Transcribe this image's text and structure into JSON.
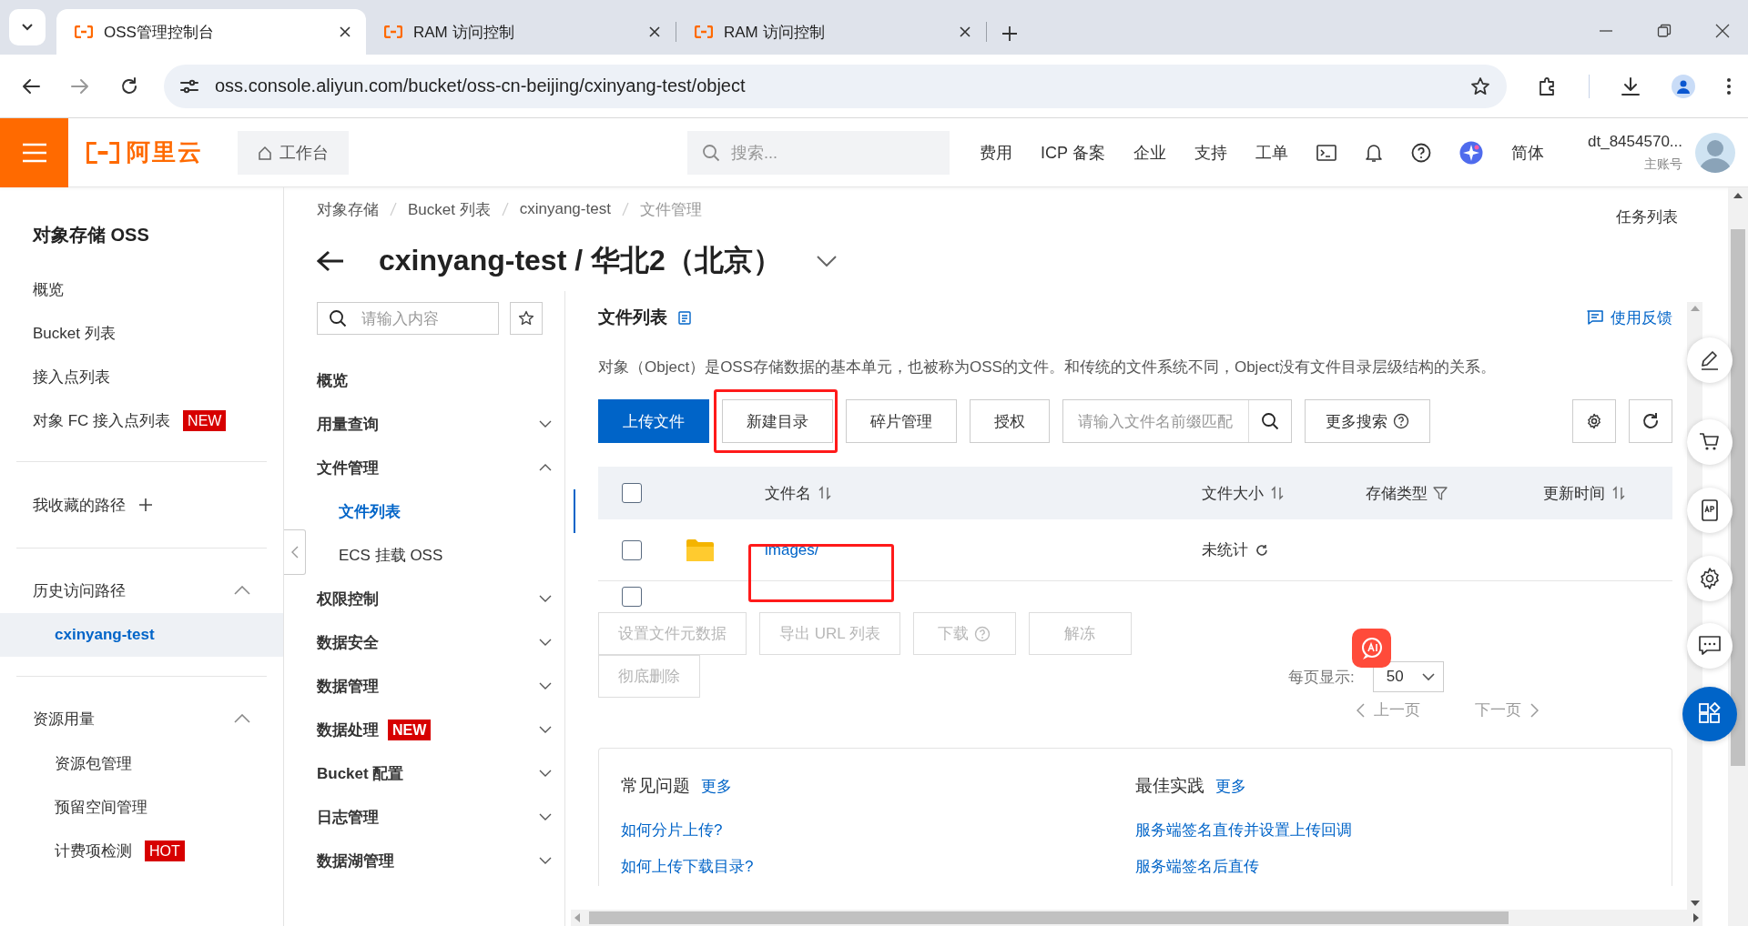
{
  "browser": {
    "tabs": [
      {
        "title": "OSS管理控制台",
        "selected": true
      },
      {
        "title": "RAM 访问控制",
        "selected": false
      },
      {
        "title": "RAM 访问控制",
        "selected": false
      }
    ],
    "url": "oss.console.aliyun.com/bucket/oss-cn-beijing/cxinyang-test/object"
  },
  "header": {
    "logo": "阿里云",
    "workbench": "工作台",
    "search_placeholder": "搜索...",
    "items": [
      {
        "kind": "text",
        "label": "费用"
      },
      {
        "kind": "text",
        "label": "ICP 备案"
      },
      {
        "kind": "text",
        "label": "企业"
      },
      {
        "kind": "text",
        "label": "支持"
      },
      {
        "kind": "text",
        "label": "工单"
      },
      {
        "kind": "terminal"
      },
      {
        "kind": "bell"
      },
      {
        "kind": "help"
      },
      {
        "kind": "assistant"
      },
      {
        "kind": "text",
        "label": "简体"
      }
    ],
    "user": "dt_8454570...",
    "account_type": "主账号"
  },
  "sidebar": {
    "title": "对象存储 OSS",
    "items": [
      {
        "label": "概览"
      },
      {
        "label": "Bucket 列表"
      },
      {
        "label": "接入点列表"
      },
      {
        "label": "对象 FC 接入点列表",
        "badge": "NEW"
      }
    ],
    "favorites": "我收藏的路径",
    "groups": [
      {
        "label": "历史访问路径",
        "expanded": true,
        "items": [
          {
            "label": "cxinyang-test",
            "selected": true
          }
        ]
      },
      {
        "label": "资源用量",
        "expanded": true,
        "items": [
          {
            "label": "资源包管理",
            "selected": false
          },
          {
            "label": "预留空间管理",
            "selected": false
          },
          {
            "label": "计费项检测",
            "selected": false,
            "badge": "HOT"
          }
        ]
      }
    ]
  },
  "breadcrumb": [
    "对象存储",
    "Bucket 列表",
    "cxinyang-test",
    "文件管理"
  ],
  "title": "cxinyang-test / 华北2（北京）",
  "task_list": "任务列表",
  "bucket_nav": {
    "search_placeholder": "请输入内容",
    "items": [
      {
        "label": "概览",
        "kind": "link"
      },
      {
        "label": "用量查询",
        "kind": "group",
        "expanded": false
      },
      {
        "label": "文件管理",
        "kind": "group",
        "expanded": true,
        "children": [
          {
            "label": "文件列表",
            "selected": true
          },
          {
            "label": "ECS 挂载 OSS",
            "selected": false
          }
        ]
      },
      {
        "label": "权限控制",
        "kind": "group",
        "expanded": false
      },
      {
        "label": "数据安全",
        "kind": "group",
        "expanded": false
      },
      {
        "label": "数据管理",
        "kind": "group",
        "expanded": false
      },
      {
        "label": "数据处理",
        "kind": "group",
        "expanded": false,
        "badge": "NEW"
      },
      {
        "label": "Bucket 配置",
        "kind": "group",
        "expanded": false
      },
      {
        "label": "日志管理",
        "kind": "group",
        "expanded": false
      },
      {
        "label": "数据湖管理",
        "kind": "group",
        "expanded": false
      }
    ]
  },
  "panel": {
    "title": "文件列表",
    "feedback": "使用反馈",
    "description": "对象（Object）是OSS存储数据的基本单元，也被称为OSS的文件。和传统的文件系统不同，Object没有文件目录层级结构的关系。",
    "toolbar": [
      {
        "label": "上传文件",
        "kind": "primary",
        "annotated": false
      },
      {
        "label": "新建目录",
        "kind": "default",
        "annotated": true
      },
      {
        "label": "碎片管理",
        "kind": "default",
        "annotated": false
      },
      {
        "label": "授权",
        "kind": "default",
        "annotated": false
      }
    ],
    "search_placeholder": "请输入文件名前缀匹配",
    "more_search": "更多搜索"
  },
  "table": {
    "select_all": false,
    "columns": [
      {
        "label": "文件名",
        "kind": "sort"
      },
      {
        "label": "文件大小",
        "kind": "sort"
      },
      {
        "label": "存储类型",
        "kind": "filter"
      },
      {
        "label": "更新时间",
        "kind": "sort"
      }
    ],
    "rows": [
      {
        "name": "images/",
        "size": "未统计",
        "checked": false,
        "annotated": true
      }
    ]
  },
  "bulk": {
    "checked": false,
    "actions": [
      {
        "label": "设置文件元数据",
        "disabled": true,
        "help": false
      },
      {
        "label": "导出 URL 列表",
        "disabled": true,
        "help": false
      },
      {
        "label": "下载",
        "disabled": true,
        "help": true
      },
      {
        "label": "解冻",
        "disabled": true,
        "help": false
      },
      {
        "label": "彻底删除",
        "disabled": true,
        "help": false
      }
    ]
  },
  "pagination": {
    "label": "每页显示:",
    "page_size": "50",
    "prev": "上一页",
    "next": "下一页"
  },
  "help": [
    {
      "title": "常见问题",
      "more": "更多",
      "links": [
        "如何分片上传?",
        "如何上传下载目录?"
      ]
    },
    {
      "title": "最佳实践",
      "more": "更多",
      "links": [
        "服务端签名直传并设置上传回调",
        "服务端签名后直传"
      ]
    }
  ]
}
